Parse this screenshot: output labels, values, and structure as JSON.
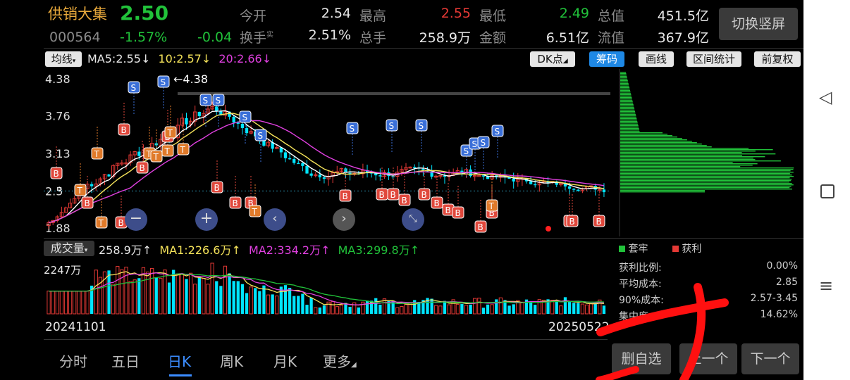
{
  "header": {
    "stock_name": "供销大集",
    "stock_code": "000564",
    "price": "2.50",
    "change_pct": "-1.57%",
    "change_amt": "-0.04",
    "switch_button": "切换竖屏",
    "stats": [
      {
        "label": "今开",
        "value": "2.54",
        "color": "white"
      },
      {
        "label": "最高",
        "value": "2.55",
        "color": "red"
      },
      {
        "label": "最低",
        "value": "2.49",
        "color": "green"
      },
      {
        "label": "总值",
        "value": "451.5亿",
        "color": "white"
      },
      {
        "label": "换手",
        "label_sup": "实",
        "value": "2.51%",
        "color": "white"
      },
      {
        "label": "总手",
        "value": "258.9万",
        "color": "white"
      },
      {
        "label": "金额",
        "value": "6.51亿",
        "color": "white"
      },
      {
        "label": "流值",
        "value": "367.9亿",
        "color": "white"
      }
    ]
  },
  "ma_bar": {
    "indicator": "均线",
    "ma5": "MA5:2.55",
    "ma10": "10:2.57",
    "ma20": "20:2.66",
    "arrow": "↓"
  },
  "toolbar": {
    "dk": "DK点",
    "chips_chip": "筹码",
    "draw": "画线",
    "range": "区间统计",
    "adjust": "前复权"
  },
  "kline": {
    "y_labels": [
      "4.38",
      "3.76",
      "3.13",
      "2.5",
      "1.88"
    ],
    "high_marker": "←4.38",
    "last_price": 2.5,
    "ylim": [
      1.88,
      4.38
    ]
  },
  "volume_bar": {
    "label": "成交量",
    "vol": "258.9万",
    "ma1": "MA1:226.6万",
    "ma2": "MA2:334.2万",
    "ma3": "MA3:299.8万",
    "up_arrow": "↑",
    "y_label": "2247万",
    "date_start": "20241101",
    "date_end": "20250522"
  },
  "chips": {
    "legend_trapped": "套牢",
    "legend_profit": "获利",
    "stats": [
      {
        "label": "获利比例:",
        "value": "0.00%"
      },
      {
        "label": "平均成本:",
        "value": "2.85"
      },
      {
        "label": "90%成本:",
        "value": "2.57-3.45"
      },
      {
        "label": "集中度:",
        "value": "14.62%"
      }
    ]
  },
  "tabs": [
    {
      "label": "分时",
      "active": false
    },
    {
      "label": "五日",
      "active": false
    },
    {
      "label": "日K",
      "active": true
    },
    {
      "label": "周K",
      "active": false
    },
    {
      "label": "月K",
      "active": false
    },
    {
      "label": "更多",
      "active": false
    }
  ],
  "bottom_buttons": {
    "delete": "删自选",
    "prev": "上一个",
    "next": "下一个"
  },
  "marker_letters": {
    "sell": "S",
    "buy": "B",
    "t": "T"
  },
  "colors": {
    "up": "#e53935",
    "down": "#00e5ff",
    "ma5": "#ffffff",
    "ma10": "#f5e35a",
    "ma20": "#e040e0",
    "ma3": "#21c23a",
    "chip_bar": "#21c23a",
    "accent": "#1e88e5"
  }
}
